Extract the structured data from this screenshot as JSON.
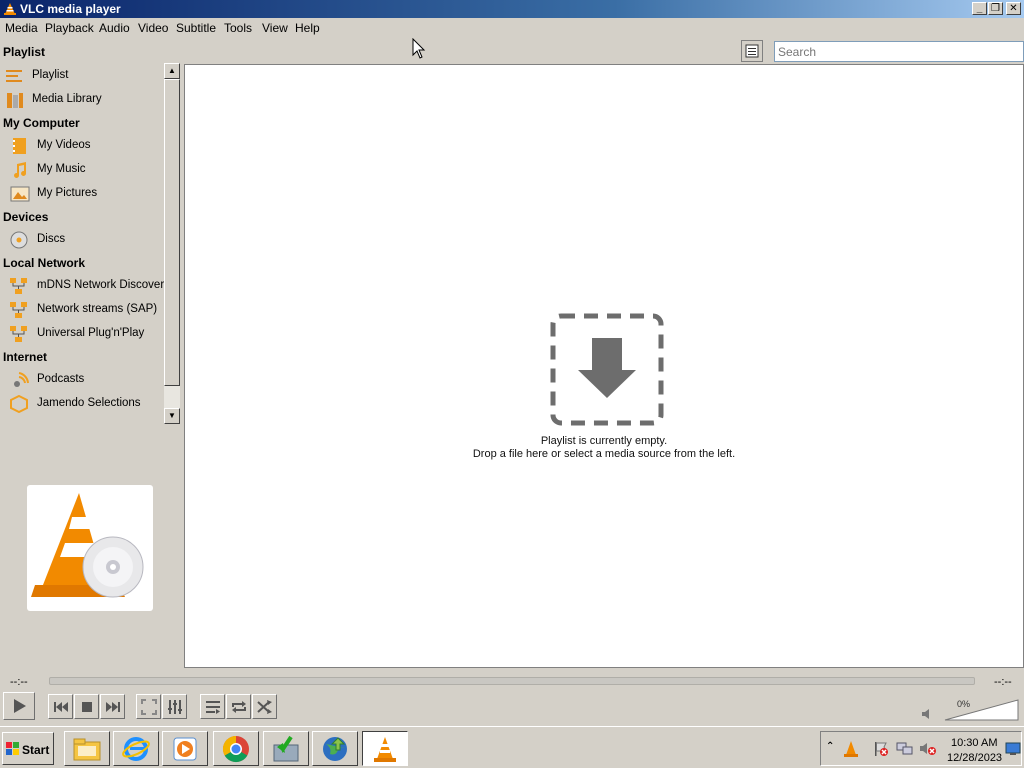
{
  "window": {
    "title": "VLC media player"
  },
  "menu": [
    "Media",
    "Playback",
    "Audio",
    "Video",
    "Subtitle",
    "Tools",
    "View",
    "Help"
  ],
  "sidebar": {
    "sections": [
      {
        "label": "Playlist",
        "items": [
          "Playlist",
          "Media Library"
        ]
      },
      {
        "label": "My Computer",
        "items": [
          "My Videos",
          "My Music",
          "My Pictures"
        ]
      },
      {
        "label": "Devices",
        "items": [
          "Discs"
        ]
      },
      {
        "label": "Local Network",
        "items": [
          "mDNS Network Discovery",
          "Network streams (SAP)",
          "Universal Plug'n'Play"
        ]
      },
      {
        "label": "Internet",
        "items": [
          "Podcasts",
          "Jamendo Selections"
        ]
      }
    ]
  },
  "search": {
    "placeholder": "Search",
    "value": ""
  },
  "playlist": {
    "empty_line1": "Playlist is currently empty.",
    "empty_line2": "Drop a file here or select a media source from the left."
  },
  "player": {
    "elapsed": "--:--",
    "remaining": "--:--",
    "volume": "0%",
    "volume_level": 0,
    "seek_position": 0
  },
  "taskbar": {
    "start_label": "Start",
    "clock_time": "10:30 AM",
    "clock_date": "12/28/2023"
  },
  "colors": {
    "vlc_orange": "#f28a00",
    "title_gradient_start": "#0a246a",
    "title_gradient_end": "#a6caf0"
  }
}
